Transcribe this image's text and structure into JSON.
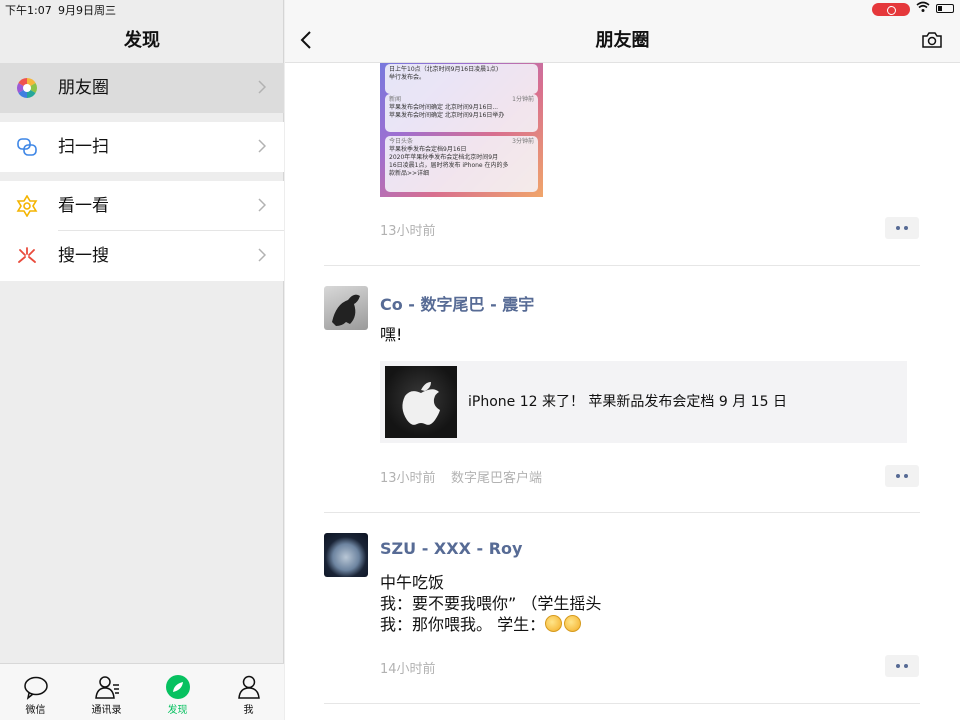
{
  "status_bar": {
    "time": "下午1:07",
    "date": "9月9日周三"
  },
  "left": {
    "title": "发现",
    "menu": [
      {
        "label": "朋友圈",
        "icon": "moments-icon"
      },
      {
        "label": "扫一扫",
        "icon": "scan-icon"
      },
      {
        "label": "看一看",
        "icon": "top-stories-icon"
      },
      {
        "label": "搜一搜",
        "icon": "search-icon"
      }
    ],
    "tabs": [
      {
        "label": "微信",
        "icon": "chat-icon"
      },
      {
        "label": "通讯录",
        "icon": "contacts-icon"
      },
      {
        "label": "发现",
        "icon": "discover-icon"
      },
      {
        "label": "我",
        "icon": "me-icon"
      }
    ],
    "active_tab": "发现"
  },
  "right": {
    "title": "朋友圈",
    "notifications": [
      {
        "app": "",
        "time": "",
        "lines": [
          "日上午10点（北京时间9月16日凌晨1点)",
          "举行发布会。"
        ]
      },
      {
        "app": "新闻",
        "time": "1分钟前",
        "lines": [
          "苹果发布会时间确定 北京时间9月16日...",
          "苹果发布会时间确定 北京时间9月16日举办"
        ]
      },
      {
        "app": "今日头条",
        "time": "3分钟前",
        "lines": [
          "苹果秋季发布会定档9月16日",
          "2020年苹果秋季发布会定档北京时间9月",
          "16日凌晨1点，届时将发布 iPhone 在内的多",
          "款新品>>详细"
        ]
      }
    ],
    "posts": [
      {
        "time": "13小时前"
      },
      {
        "name": "Co - 数字尾巴 - 震宇",
        "text": "嘿!",
        "link_title": "iPhone 12 来了！ 苹果新品发布会定档 9 月 15 日",
        "time": "13小时前",
        "source": "数字尾巴客户端"
      },
      {
        "name": "SZU - XXX - Roy",
        "lines": [
          "中午吃饭",
          "我：要不要我喂你”  （学生摇头",
          "我：那你喂我。 学生："
        ],
        "time": "14小时前"
      }
    ]
  },
  "colors": {
    "accent": "#07c160",
    "link": "#576b95",
    "record": "#e5383b"
  }
}
